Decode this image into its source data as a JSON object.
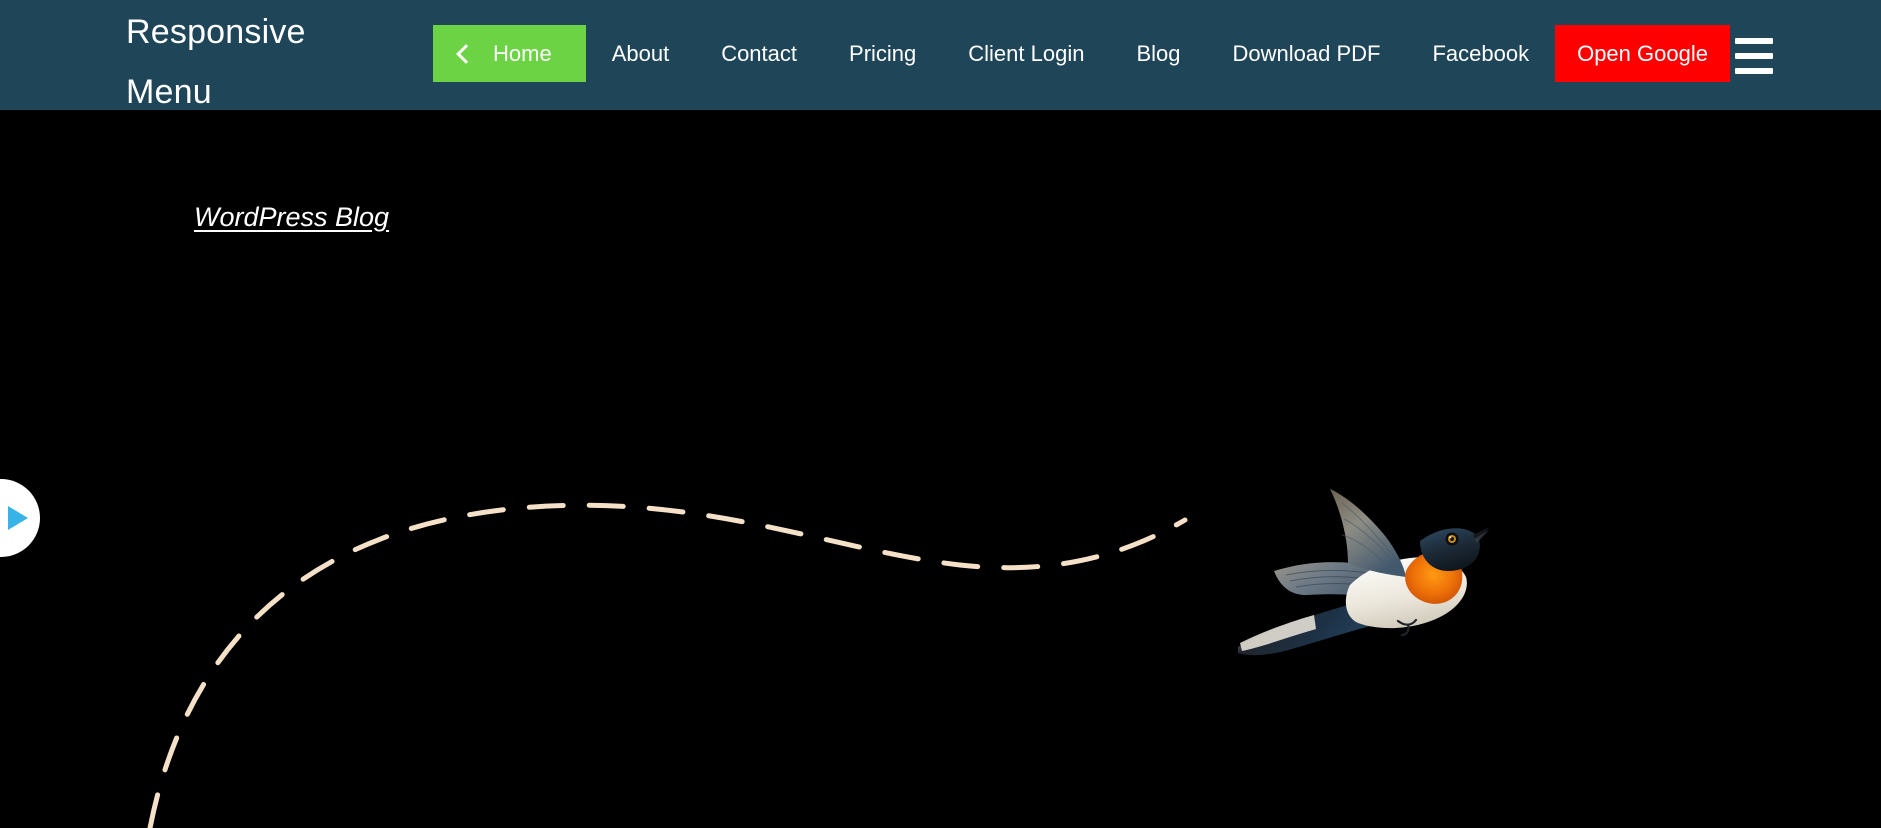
{
  "header": {
    "brand": "Responsive Menu",
    "background_color": "#1e4558",
    "nav_items": [
      {
        "label": "Home",
        "state": "active",
        "icon": "chevron-left-icon",
        "bg": "#6cd444"
      },
      {
        "label": "About",
        "state": "default",
        "icon": null,
        "bg": null
      },
      {
        "label": "Contact",
        "state": "default",
        "icon": null,
        "bg": null
      },
      {
        "label": "Pricing",
        "state": "default",
        "icon": null,
        "bg": null
      },
      {
        "label": "Client Login",
        "state": "default",
        "icon": null,
        "bg": null
      },
      {
        "label": "Blog",
        "state": "default",
        "icon": null,
        "bg": null
      },
      {
        "label": "Download PDF",
        "state": "default",
        "icon": null,
        "bg": null
      },
      {
        "label": "Facebook",
        "state": "default",
        "icon": null,
        "bg": null
      },
      {
        "label": "Open Google",
        "state": "danger",
        "icon": null,
        "bg": "#ff0000"
      }
    ],
    "menu_toggle": {
      "icon": "hamburger-icon",
      "bar_count": 3,
      "color": "#ffffff"
    }
  },
  "hero": {
    "background_color": "#000000",
    "blog_link": "WordPress Blog",
    "slider_prev": {
      "icon": "play-triangle-icon",
      "circle_color": "#ffffff",
      "triangle_color": "#37b3e8"
    },
    "flight_path": {
      "color": "#f5e0c8",
      "style": "dashed"
    },
    "bird": {
      "alt": "flying bird illustration",
      "throat_color": "#e8700a",
      "wing_color": "#2c4558",
      "belly_color": "#f0ece2"
    }
  }
}
